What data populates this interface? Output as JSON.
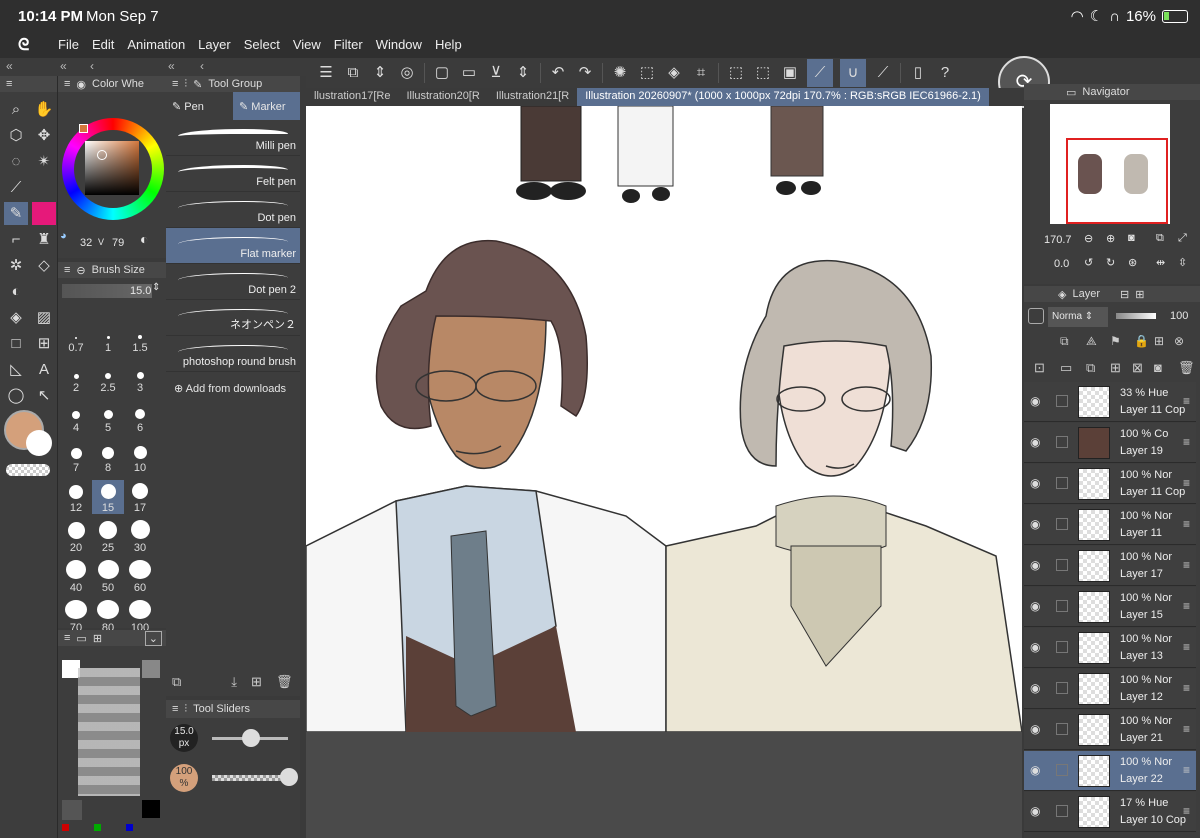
{
  "status": {
    "time": "10:14 PM",
    "date": "Mon Sep 7",
    "battery": "16%"
  },
  "menu": [
    "File",
    "Edit",
    "Animation",
    "Layer",
    "Select",
    "View",
    "Filter",
    "Window",
    "Help"
  ],
  "color_panel": {
    "title": "Color Whe",
    "v1": "32",
    "v_label": "V",
    "v2": "79",
    "current_color": "#d4a07b"
  },
  "brush_size": {
    "title": "Brush Size",
    "value": "15.0",
    "presets": [
      "0.7",
      "1",
      "1.5",
      "2",
      "2.5",
      "3",
      "4",
      "5",
      "6",
      "7",
      "8",
      "10",
      "12",
      "15",
      "17",
      "20",
      "25",
      "30",
      "40",
      "50",
      "60",
      "70",
      "80",
      "100"
    ],
    "selected": "15"
  },
  "sub_tool": {
    "title": "Tool Group",
    "tabs": [
      "Pen",
      "Marker"
    ],
    "active_tab": "Marker",
    "brushes": [
      "Milli pen",
      "Felt pen",
      "Dot pen",
      "Flat marker",
      "Dot pen 2",
      "ネオンペン２",
      "photoshop round  brush"
    ],
    "selected_brush": "Flat marker",
    "add_label": "Add from downloads"
  },
  "tool_sliders": {
    "title": "Tool Sliders",
    "size": "15.0",
    "size_unit": "px",
    "opacity": "100",
    "opacity_unit": "%"
  },
  "tabs": [
    "llustration17[Re",
    "Illustration20[R",
    "Illustration21[R"
  ],
  "active_tab": "Illustration 20260907* (1000 x 1000px 72dpi 170.7% : RGB:sRGB IEC61966-2.1)",
  "navigator": {
    "title": "Navigator",
    "zoom": "170.7",
    "rotation": "0.0"
  },
  "layers": {
    "title": "Layer",
    "blend": "Norma",
    "opacity": "100",
    "items": [
      {
        "pct": "33 %",
        "mode": "Hue",
        "name": "Layer 11 Cop"
      },
      {
        "pct": "100 %",
        "mode": "Co",
        "name": "Layer 19"
      },
      {
        "pct": "100 %",
        "mode": "Nor",
        "name": "Layer 11 Cop"
      },
      {
        "pct": "100 %",
        "mode": "Nor",
        "name": "Layer 11"
      },
      {
        "pct": "100 %",
        "mode": "Nor",
        "name": "Layer 17"
      },
      {
        "pct": "100 %",
        "mode": "Nor",
        "name": "Layer 15"
      },
      {
        "pct": "100 %",
        "mode": "Nor",
        "name": "Layer 13"
      },
      {
        "pct": "100 %",
        "mode": "Nor",
        "name": "Layer 12"
      },
      {
        "pct": "100 %",
        "mode": "Nor",
        "name": "Layer 21"
      },
      {
        "pct": "100 %",
        "mode": "Nor",
        "name": "Layer 22"
      },
      {
        "pct": "17 %",
        "mode": "Hue",
        "name": "Layer 10 Cop"
      }
    ],
    "selected_index": 9
  }
}
